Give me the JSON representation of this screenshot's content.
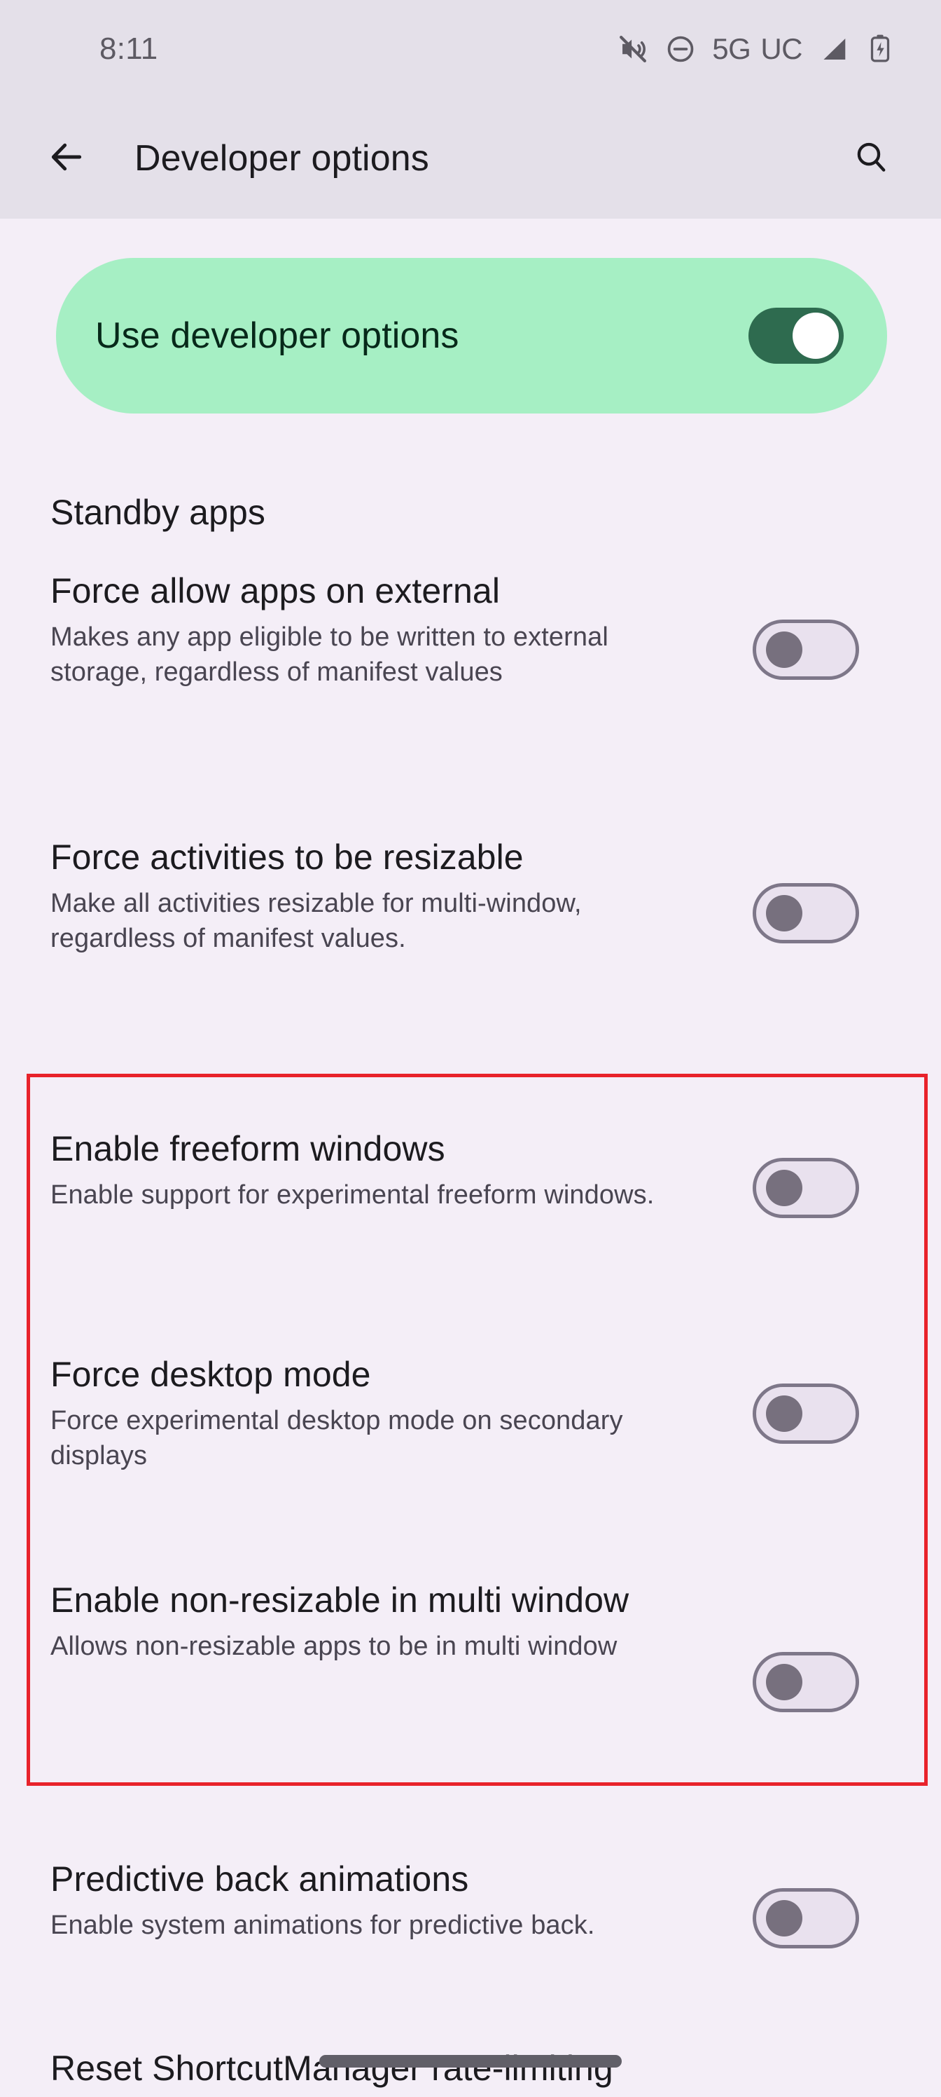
{
  "status_bar": {
    "time": "8:11",
    "network_label": "5G",
    "network_suffix": "UC",
    "icons": [
      "volume-muted-icon",
      "do-not-disturb-icon",
      "signal-bar-icon",
      "battery-charging-icon"
    ]
  },
  "app_bar": {
    "back_label": "back-arrow",
    "title": "Developer options",
    "search_label": "search"
  },
  "master_switch": {
    "label": "Use developer options",
    "state": "on",
    "card_color": "#A6EFC4",
    "track_color": "#2E6B4F",
    "thumb_color": "#FFFFFF"
  },
  "section": {
    "header": "Standby apps"
  },
  "settings": [
    {
      "title": "Force allow apps on external",
      "description": "Makes any app eligible to be written to external storage, regardless of manifest values",
      "state": "off"
    },
    {
      "title": "Force activities to be resizable",
      "description": "Make all activities resizable for multi-window, regardless of manifest values.",
      "state": "off"
    },
    {
      "title": "Enable freeform windows",
      "description": "Enable support for experimental freeform windows.",
      "state": "off"
    },
    {
      "title": "Force desktop mode",
      "description": "Force experimental desktop mode on secondary displays",
      "state": "off"
    },
    {
      "title": "Enable non-resizable in multi window",
      "description": "Allows non-resizable apps to be in multi window",
      "state": "off"
    },
    {
      "title": "Predictive back animations",
      "description": "Enable system animations for predictive back.",
      "state": "off"
    },
    {
      "title": "Reset ShortcutManager rate-limiting",
      "description": "",
      "state": "none"
    }
  ],
  "annotation": {
    "color": "#E8222B",
    "highlights": [
      "Enable freeform windows",
      "Force desktop mode",
      "Enable non-resizable in multi window"
    ]
  },
  "colors": {
    "background": "#F4EEF7",
    "app_bar_background": "#E4E0E9",
    "title_text": "#1C1B1F",
    "body_text": "#494551",
    "switch_off_border": "#7E7789",
    "switch_off_thumb": "#77707E"
  }
}
